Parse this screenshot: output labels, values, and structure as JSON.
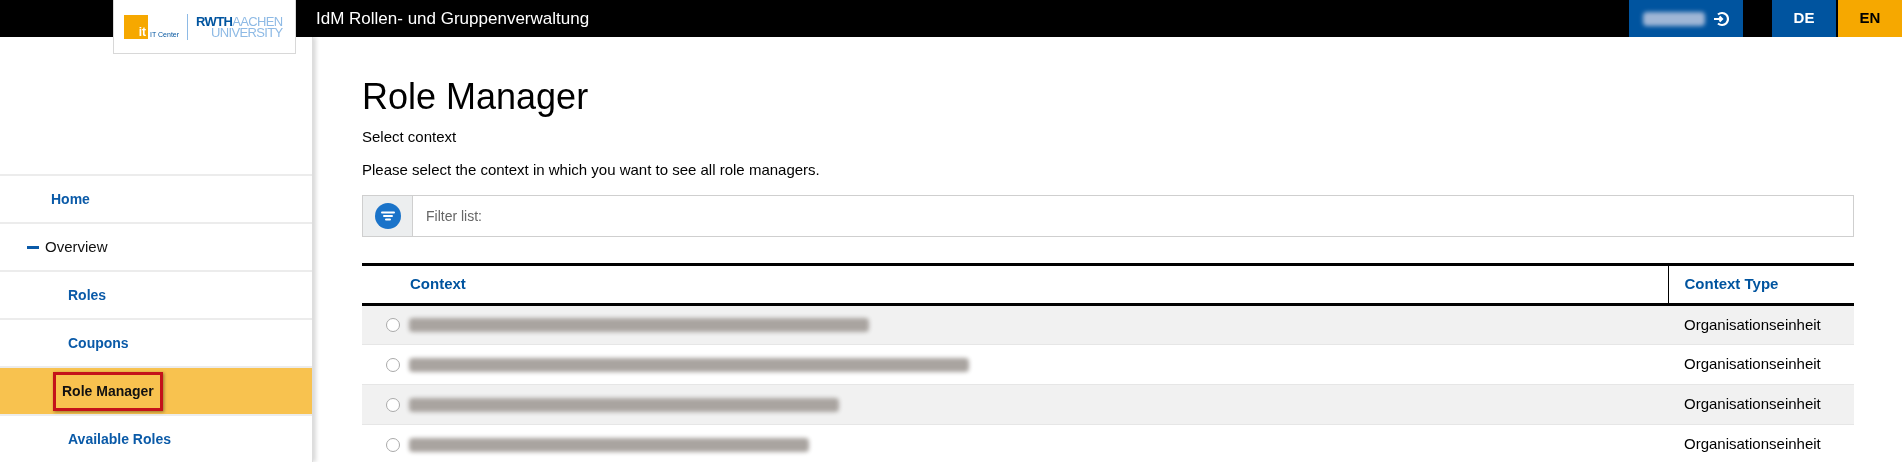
{
  "header": {
    "logo": {
      "badge": "it",
      "caption": "IT Center",
      "wordmark_bold": "RWTH",
      "wordmark_light": "AACHEN",
      "wordmark_line2": "UNIVERSITY"
    },
    "title": "IdM Rollen- und Gruppenverwaltung",
    "user": {
      "name": {
        "kind": "redacted"
      }
    },
    "languages": [
      {
        "label": "DE",
        "selected": false
      },
      {
        "label": "EN",
        "selected": true
      }
    ]
  },
  "sidebar": {
    "items": [
      {
        "label": "Home",
        "selected": false
      },
      {
        "label": "Overview",
        "expanded": true,
        "children": [
          {
            "label": "Roles",
            "selected": false
          },
          {
            "label": "Coupons",
            "selected": false
          },
          {
            "label": "Role Manager",
            "selected": true
          },
          {
            "label": "Available Roles",
            "selected": false
          }
        ]
      }
    ]
  },
  "page": {
    "title": "Role Manager",
    "subtitle": "Select context",
    "description": "Please select the context in which you want to see all role managers.",
    "filter": {
      "placeholder": "Filter list:"
    }
  },
  "table": {
    "columns": [
      "Context",
      "Context Type"
    ],
    "rows": [
      {
        "selected": false,
        "context": {
          "kind": "redacted"
        },
        "context_type": "Organisationseinheit"
      },
      {
        "selected": false,
        "context": {
          "kind": "redacted"
        },
        "context_type": "Organisationseinheit"
      },
      {
        "selected": false,
        "context": {
          "kind": "redacted"
        },
        "context_type": "Organisationseinheit"
      },
      {
        "selected": false,
        "context": {
          "kind": "redacted"
        },
        "context_type": "Organisationseinheit"
      }
    ]
  }
}
